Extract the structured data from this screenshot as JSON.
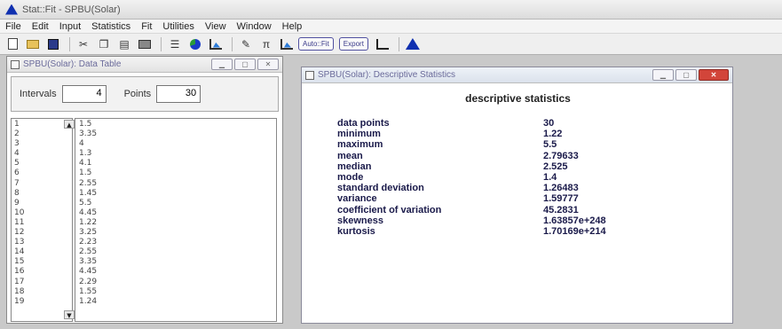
{
  "app": {
    "title": "Stat::Fit - SPBU(Solar)"
  },
  "menu": [
    "File",
    "Edit",
    "Input",
    "Statistics",
    "Fit",
    "Utilities",
    "View",
    "Window",
    "Help"
  ],
  "toolbar": {
    "auto_fit_label": "Auto::Fit",
    "export_label": "Export"
  },
  "data_table": {
    "title": "SPBU(Solar): Data Table",
    "intervals_label": "Intervals",
    "intervals_value": "4",
    "points_label": "Points",
    "points_value": "30",
    "row_numbers": [
      "1",
      "2",
      "3",
      "4",
      "5",
      "6",
      "7",
      "8",
      "9",
      "10",
      "11",
      "12",
      "13",
      "14",
      "15",
      "16",
      "17",
      "18",
      "19"
    ],
    "values": [
      "1.5",
      "3.35",
      "4",
      "1.3",
      "4.1",
      "1.5",
      "2.55",
      "1.45",
      "5.5",
      "4.45",
      "1.22",
      "3.25",
      "2.23",
      "2.55",
      "3.35",
      "4.45",
      "2.29",
      "1.55",
      "1.24"
    ]
  },
  "stats_window": {
    "title": "SPBU(Solar): Descriptive Statistics",
    "heading": "descriptive statistics",
    "stats": [
      {
        "label": "data points",
        "value": "30"
      },
      {
        "label": "minimum",
        "value": "1.22"
      },
      {
        "label": "maximum",
        "value": "5.5"
      },
      {
        "label": "mean",
        "value": "2.79633"
      },
      {
        "label": "median",
        "value": "2.525"
      },
      {
        "label": "mode",
        "value": "1.4"
      },
      {
        "label": "standard deviation",
        "value": "1.26483"
      },
      {
        "label": "variance",
        "value": "1.59777"
      },
      {
        "label": "coefficient of variation",
        "value": "45.2831"
      },
      {
        "label": "skewness",
        "value": "1.63857e+248"
      },
      {
        "label": "kurtosis",
        "value": "1.70169e+214"
      }
    ]
  }
}
